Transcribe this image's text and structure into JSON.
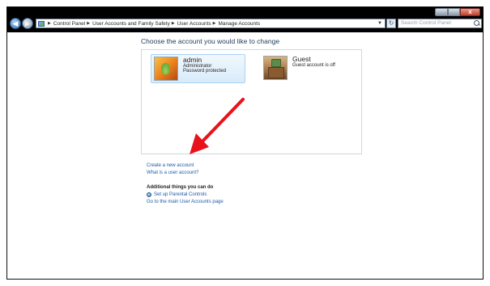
{
  "window": {
    "controls": {
      "minimize": "",
      "maximize": "",
      "close": "x"
    }
  },
  "navbar": {
    "back": "◀",
    "forward": "▶",
    "breadcrumbs": [
      {
        "label": "Control Panel"
      },
      {
        "label": "User Accounts and Family Safety"
      },
      {
        "label": "User Accounts"
      },
      {
        "label": "Manage Accounts"
      }
    ],
    "search_placeholder": "Search Control Panel"
  },
  "main": {
    "title": "Choose the account you would like to change",
    "accounts": [
      {
        "name": "admin",
        "lines": [
          "Administrator",
          "Password protected"
        ],
        "selected": true
      },
      {
        "name": "Guest",
        "lines": [
          "Guest account is off"
        ],
        "selected": false
      }
    ],
    "links": {
      "create": "Create a new account",
      "what_is": "What is a user account?"
    },
    "additional": {
      "title": "Additional things you can do",
      "parental": "Set up Parental Controls",
      "main_page": "Go to the main User Accounts page"
    }
  },
  "colors": {
    "link": "#1e5aa8",
    "title": "#1e395b",
    "annotation_arrow": "#e8121c",
    "titlebar": "#000000"
  },
  "icons": [
    "control-panel-icon",
    "search-icon",
    "parental-controls-icon",
    "admin-avatar-icon",
    "guest-avatar-icon"
  ]
}
